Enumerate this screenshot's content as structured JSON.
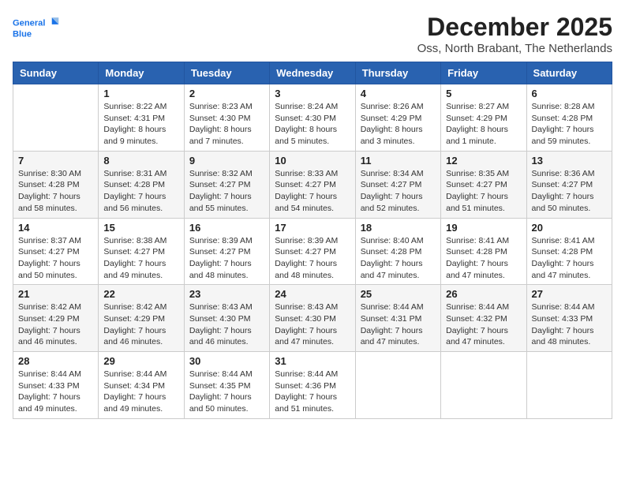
{
  "header": {
    "logo_text_general": "General",
    "logo_text_blue": "Blue",
    "month": "December 2025",
    "location": "Oss, North Brabant, The Netherlands"
  },
  "days_of_week": [
    "Sunday",
    "Monday",
    "Tuesday",
    "Wednesday",
    "Thursday",
    "Friday",
    "Saturday"
  ],
  "weeks": [
    [
      {
        "day": "",
        "info": ""
      },
      {
        "day": "1",
        "info": "Sunrise: 8:22 AM\nSunset: 4:31 PM\nDaylight: 8 hours\nand 9 minutes."
      },
      {
        "day": "2",
        "info": "Sunrise: 8:23 AM\nSunset: 4:30 PM\nDaylight: 8 hours\nand 7 minutes."
      },
      {
        "day": "3",
        "info": "Sunrise: 8:24 AM\nSunset: 4:30 PM\nDaylight: 8 hours\nand 5 minutes."
      },
      {
        "day": "4",
        "info": "Sunrise: 8:26 AM\nSunset: 4:29 PM\nDaylight: 8 hours\nand 3 minutes."
      },
      {
        "day": "5",
        "info": "Sunrise: 8:27 AM\nSunset: 4:29 PM\nDaylight: 8 hours\nand 1 minute."
      },
      {
        "day": "6",
        "info": "Sunrise: 8:28 AM\nSunset: 4:28 PM\nDaylight: 7 hours\nand 59 minutes."
      }
    ],
    [
      {
        "day": "7",
        "info": "Sunrise: 8:30 AM\nSunset: 4:28 PM\nDaylight: 7 hours\nand 58 minutes."
      },
      {
        "day": "8",
        "info": "Sunrise: 8:31 AM\nSunset: 4:28 PM\nDaylight: 7 hours\nand 56 minutes."
      },
      {
        "day": "9",
        "info": "Sunrise: 8:32 AM\nSunset: 4:27 PM\nDaylight: 7 hours\nand 55 minutes."
      },
      {
        "day": "10",
        "info": "Sunrise: 8:33 AM\nSunset: 4:27 PM\nDaylight: 7 hours\nand 54 minutes."
      },
      {
        "day": "11",
        "info": "Sunrise: 8:34 AM\nSunset: 4:27 PM\nDaylight: 7 hours\nand 52 minutes."
      },
      {
        "day": "12",
        "info": "Sunrise: 8:35 AM\nSunset: 4:27 PM\nDaylight: 7 hours\nand 51 minutes."
      },
      {
        "day": "13",
        "info": "Sunrise: 8:36 AM\nSunset: 4:27 PM\nDaylight: 7 hours\nand 50 minutes."
      }
    ],
    [
      {
        "day": "14",
        "info": "Sunrise: 8:37 AM\nSunset: 4:27 PM\nDaylight: 7 hours\nand 50 minutes."
      },
      {
        "day": "15",
        "info": "Sunrise: 8:38 AM\nSunset: 4:27 PM\nDaylight: 7 hours\nand 49 minutes."
      },
      {
        "day": "16",
        "info": "Sunrise: 8:39 AM\nSunset: 4:27 PM\nDaylight: 7 hours\nand 48 minutes."
      },
      {
        "day": "17",
        "info": "Sunrise: 8:39 AM\nSunset: 4:27 PM\nDaylight: 7 hours\nand 48 minutes."
      },
      {
        "day": "18",
        "info": "Sunrise: 8:40 AM\nSunset: 4:28 PM\nDaylight: 7 hours\nand 47 minutes."
      },
      {
        "day": "19",
        "info": "Sunrise: 8:41 AM\nSunset: 4:28 PM\nDaylight: 7 hours\nand 47 minutes."
      },
      {
        "day": "20",
        "info": "Sunrise: 8:41 AM\nSunset: 4:28 PM\nDaylight: 7 hours\nand 47 minutes."
      }
    ],
    [
      {
        "day": "21",
        "info": "Sunrise: 8:42 AM\nSunset: 4:29 PM\nDaylight: 7 hours\nand 46 minutes."
      },
      {
        "day": "22",
        "info": "Sunrise: 8:42 AM\nSunset: 4:29 PM\nDaylight: 7 hours\nand 46 minutes."
      },
      {
        "day": "23",
        "info": "Sunrise: 8:43 AM\nSunset: 4:30 PM\nDaylight: 7 hours\nand 46 minutes."
      },
      {
        "day": "24",
        "info": "Sunrise: 8:43 AM\nSunset: 4:30 PM\nDaylight: 7 hours\nand 47 minutes."
      },
      {
        "day": "25",
        "info": "Sunrise: 8:44 AM\nSunset: 4:31 PM\nDaylight: 7 hours\nand 47 minutes."
      },
      {
        "day": "26",
        "info": "Sunrise: 8:44 AM\nSunset: 4:32 PM\nDaylight: 7 hours\nand 47 minutes."
      },
      {
        "day": "27",
        "info": "Sunrise: 8:44 AM\nSunset: 4:33 PM\nDaylight: 7 hours\nand 48 minutes."
      }
    ],
    [
      {
        "day": "28",
        "info": "Sunrise: 8:44 AM\nSunset: 4:33 PM\nDaylight: 7 hours\nand 49 minutes."
      },
      {
        "day": "29",
        "info": "Sunrise: 8:44 AM\nSunset: 4:34 PM\nDaylight: 7 hours\nand 49 minutes."
      },
      {
        "day": "30",
        "info": "Sunrise: 8:44 AM\nSunset: 4:35 PM\nDaylight: 7 hours\nand 50 minutes."
      },
      {
        "day": "31",
        "info": "Sunrise: 8:44 AM\nSunset: 4:36 PM\nDaylight: 7 hours\nand 51 minutes."
      },
      {
        "day": "",
        "info": ""
      },
      {
        "day": "",
        "info": ""
      },
      {
        "day": "",
        "info": ""
      }
    ]
  ]
}
